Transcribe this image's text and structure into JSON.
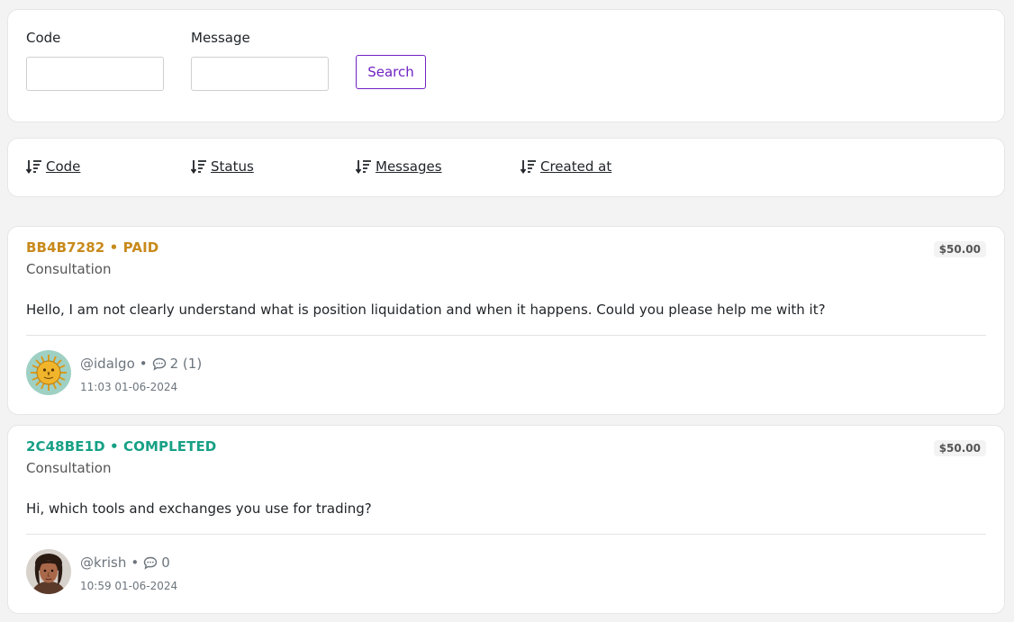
{
  "filters": {
    "code_label": "Code",
    "code_value": "",
    "message_label": "Message",
    "message_value": "",
    "search_label": "Search"
  },
  "sort": [
    {
      "label": "Code",
      "icon": "sort-descending-icon"
    },
    {
      "label": "Status",
      "icon": "sort-descending-icon"
    },
    {
      "label": "Messages",
      "icon": "sort-descending-icon"
    },
    {
      "label": "Created at",
      "icon": "sort-descending-icon"
    }
  ],
  "tickets": [
    {
      "code": "BB4B7282",
      "status": "PAID",
      "separator": "•",
      "status_color": "#c88a1c",
      "type": "Consultation",
      "price": "$50.00",
      "message": "Hello, I am not clearly understand what is position liquidation and when it happens. Could you please help me with it?",
      "user": "@idalgo",
      "comments": "2 (1)",
      "time": "11:03 01-06-2024",
      "avatar": "sun-avatar"
    },
    {
      "code": "2C48BE1D",
      "status": "COMPLETED",
      "separator": "•",
      "status_color": "#17a085",
      "type": "Consultation",
      "price": "$50.00",
      "message": "Hi, which tools and exchanges you use for trading?",
      "user": "@krish",
      "comments": "0",
      "time": "10:59 01-06-2024",
      "avatar": "person-avatar"
    }
  ],
  "colors": {
    "accent": "#6f22c2",
    "paid": "#c88a1c",
    "completed": "#17a085",
    "muted": "#6c757d"
  }
}
